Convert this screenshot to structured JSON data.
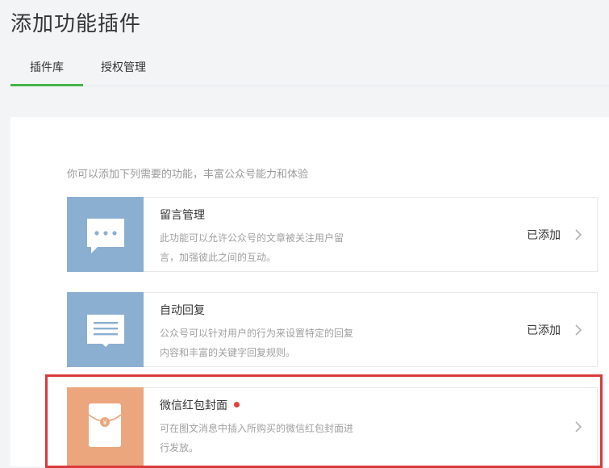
{
  "page": {
    "title": "添加功能插件"
  },
  "tabs": [
    {
      "label": "插件库",
      "active": true
    },
    {
      "label": "授权管理",
      "active": false
    }
  ],
  "panel": {
    "intro": "你可以添加下列需要的功能，丰富公众号能力和体验"
  },
  "plugins": [
    {
      "name": "留言管理",
      "description": "此功能可以允许公众号的文章被关注用户留言，加强彼此之间的互动。",
      "status": "已添加",
      "icon": "speech-bubble-icon",
      "thumb_color": "#8bafd1"
    },
    {
      "name": "自动回复",
      "description": "公众号可以针对用户的行为来设置特定的回复内容和丰富的关键字回复规则。",
      "status": "已添加",
      "icon": "message-lines-icon",
      "thumb_color": "#8bafd1"
    },
    {
      "name": "微信红包封面",
      "description": "可在图文消息中插入所购买的微信红包封面进行发放。",
      "status": "",
      "icon": "red-envelope-icon",
      "thumb_color": "#eba67e",
      "has_new_dot": true
    }
  ],
  "colors": {
    "accent_green": "#44b549",
    "highlight_red": "#d93a3c",
    "new_dot": "#e1413b"
  }
}
